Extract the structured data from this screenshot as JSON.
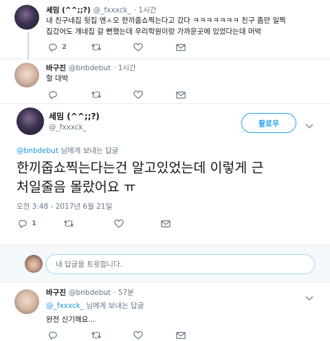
{
  "tweets": [
    {
      "name": "세밈 (^^;;?)",
      "handle": "@_fxxxck_",
      "time": "· 1시간",
      "lines": [
        "내 친구네집 뒷집 엔ㅅ오 한끼줍쇼찍는다고 갔다 ㅋㅋㅋㅋㅋㅋㅋ 친구 좀만 일찍",
        "집갔어도 걔네집 갈 뻔했는데 우리학원이랑 가까운곳에 있었다는데 머박"
      ],
      "reply_count": "2"
    },
    {
      "name": "바구진",
      "handle": "@bnbdebut",
      "time": "· 1시간",
      "lines": [
        "헐 대박"
      ]
    }
  ],
  "main_tweet": {
    "name": "세밈 (^^;;?)",
    "handle": "@_fxxxck_",
    "follow_label": "팔로우",
    "reply_to_user": "@bnbdebut",
    "reply_to_suffix": " 님에게 보내는 답글",
    "text_lines": [
      "한끼줍쇼찍는다는건 알고있었는데 이렇게 근",
      "처일줄음 몰랐어요 ㅠ"
    ],
    "timestamp": "오전 3:48 - 2017년 6월 21일",
    "reply_count": "1"
  },
  "reply_composer": {
    "placeholder": "내 답글을 트윗합니다."
  },
  "bottom_reply": {
    "name": "바구진",
    "handle": "@bnbdebut",
    "time": "· 57분",
    "reply_to_user": "@_fxxxck_",
    "reply_to_suffix": " 님에게 보내는 답글",
    "text": "완전 신기해요..."
  },
  "icons": {
    "reply": "reply-icon",
    "retweet": "retweet-icon",
    "like": "heart-icon",
    "dm": "envelope-icon",
    "more": "chevron-down-icon"
  },
  "colors": {
    "accent": "#1da1f2",
    "link": "#1b95e0",
    "muted": "#657786"
  }
}
